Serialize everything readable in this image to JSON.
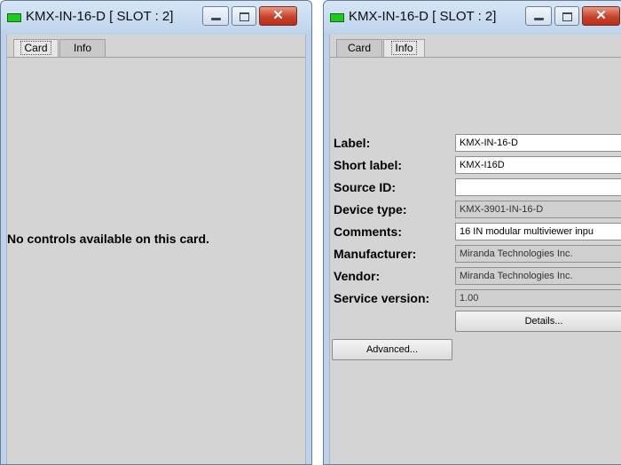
{
  "left_window": {
    "title": "KMX-IN-16-D [ SLOT : 2]",
    "tabs": [
      "Card",
      "Info"
    ],
    "message": "No controls available on this card."
  },
  "right_window": {
    "title": "KMX-IN-16-D [ SLOT : 2]",
    "tabs": [
      "Card",
      "Info"
    ],
    "fields": [
      {
        "label": "Label:",
        "value": "KMX-IN-16-D"
      },
      {
        "label": "Short label:",
        "value": "KMX-I16D"
      },
      {
        "label": "Source ID:",
        "value": ""
      },
      {
        "label": "Device type:",
        "value": "KMX-3901-IN-16-D"
      },
      {
        "label": "Comments:",
        "value": "16 IN modular multiviewer inpu"
      },
      {
        "label": "Manufacturer:",
        "value": "Miranda Technologies Inc."
      },
      {
        "label": "Vendor:",
        "value": "Miranda Technologies Inc."
      },
      {
        "label": "Service version:",
        "value": "1.00"
      }
    ],
    "details_button": "Details...",
    "advanced_button": "Advanced..."
  },
  "colors": {
    "title_icon": "#1fc91f",
    "close_button": "#c7412a",
    "panel_background": "#d4d4d4"
  },
  "icons": {
    "title": "green-led-icon",
    "minimize": "minimize-icon",
    "maximize": "maximize-icon",
    "close": "close-icon"
  }
}
